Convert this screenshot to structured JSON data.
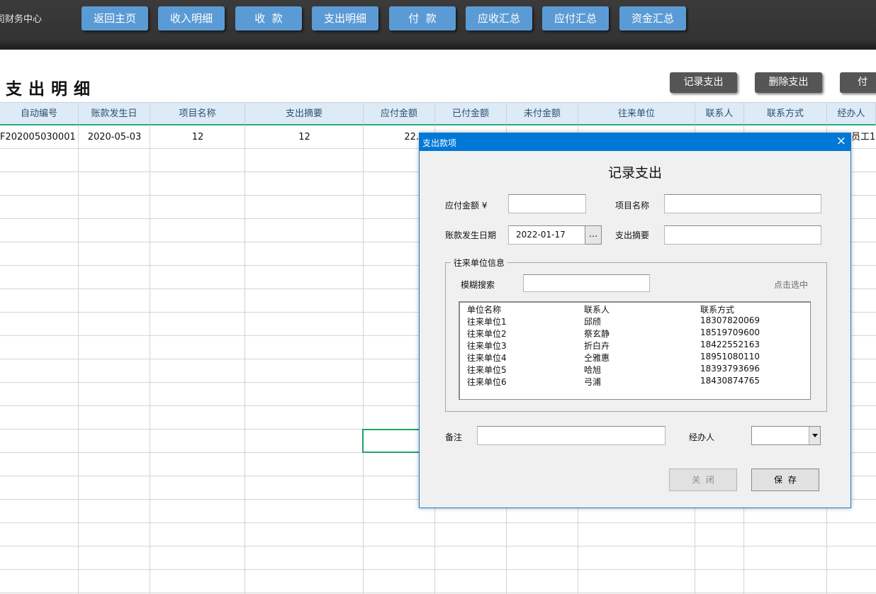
{
  "topbar": {
    "title": "司财务中心",
    "nav": [
      "返回主页",
      "收入明细",
      "收  款",
      "支出明细",
      "付  款",
      "应收汇总",
      "应付汇总",
      "资金汇总"
    ]
  },
  "sheet": {
    "title": "支出明细",
    "actions": [
      "记录支出",
      "删除支出",
      "付"
    ]
  },
  "table": {
    "columns": [
      "自动编号",
      "账款发生日",
      "项目名称",
      "支出摘要",
      "应付金额",
      "已付金额",
      "未付金额",
      "往来单位",
      "联系人",
      "联系方式",
      "经办人"
    ],
    "rows": [
      [
        "F202005030001",
        "2020-05-03",
        "12",
        "12",
        "22.",
        "",
        "",
        "",
        "",
        "",
        "员工1"
      ]
    ]
  },
  "dialog": {
    "title": "支出款项",
    "close_icon": "×",
    "heading": "记录支出",
    "amount_label": "应付金额 ¥",
    "amount_value": "",
    "project_label": "项目名称",
    "project_value": "",
    "date_label": "账款发生日期",
    "date_value": "2022-01-17",
    "date_button": "…",
    "summary_label": "支出摘要",
    "summary_value": "",
    "group_title": "往来单位信息",
    "search_label": "模糊搜索",
    "search_value": "",
    "hint": "点击选中",
    "list_header": [
      "单位名称",
      "联系人",
      "联系方式"
    ],
    "list_rows": [
      [
        "往来单位1",
        "邱颀",
        "18307820069"
      ],
      [
        "往来单位2",
        "祭玄静",
        "18519709600"
      ],
      [
        "往来单位3",
        "折白卉",
        "18422552163"
      ],
      [
        "往来单位4",
        "仝雅惠",
        "18951080110"
      ],
      [
        "往来单位5",
        "哈旭",
        "18393793696"
      ],
      [
        "往来单位6",
        "弓浦",
        "18430874765"
      ]
    ],
    "note_label": "备注",
    "note_value": "",
    "handler_label": "经办人",
    "handler_value": "",
    "close_button": "关  闭",
    "save_button": "保  存"
  },
  "colors": {
    "nav_button": "#5b9bd5",
    "header_fill": "#ddebf7",
    "dialog_titlebar": "#0078d7",
    "selection": "#21a366"
  }
}
